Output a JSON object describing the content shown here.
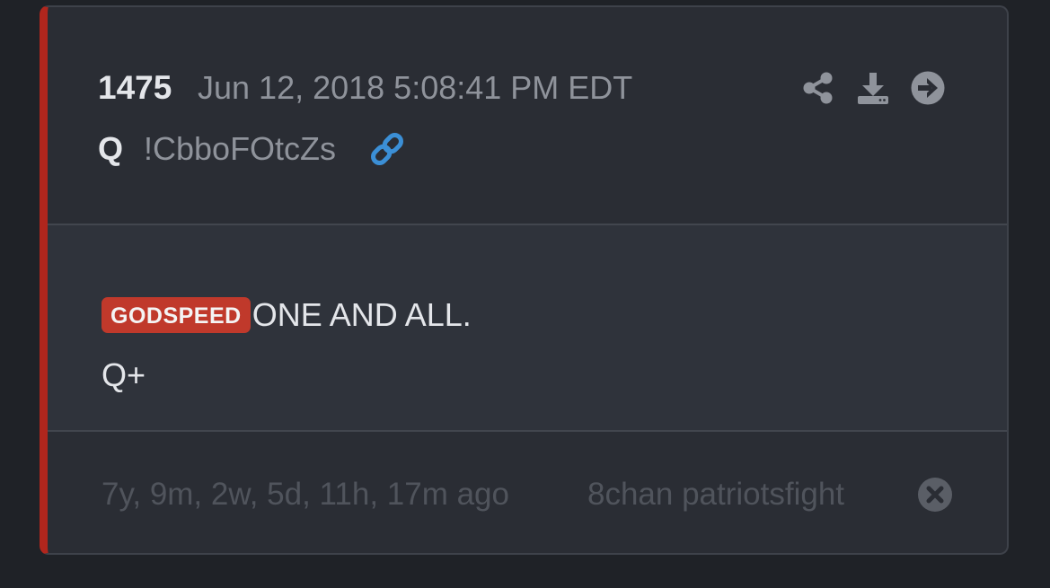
{
  "post": {
    "number": "1475",
    "date": "Jun 12, 2018 5:08:41 PM EDT",
    "author": "Q",
    "tripcode": "!CbboFOtcZs",
    "tag": "GODSPEED",
    "line1": "ONE AND ALL.",
    "line2": "Q+",
    "ago": "7y, 9m, 2w, 5d, 11h, 17m ago",
    "source": "8chan patriotsfight"
  },
  "icons": {
    "share": "share-icon",
    "download": "download-icon",
    "goto": "arrow-right-circle-icon",
    "link": "link-icon",
    "close": "close-circle-icon"
  },
  "colors": {
    "accent_bar": "#b0261d",
    "tag_badge": "#c0392b",
    "link_icon": "#3b8fd6",
    "muted_icon": "#8f939b"
  }
}
